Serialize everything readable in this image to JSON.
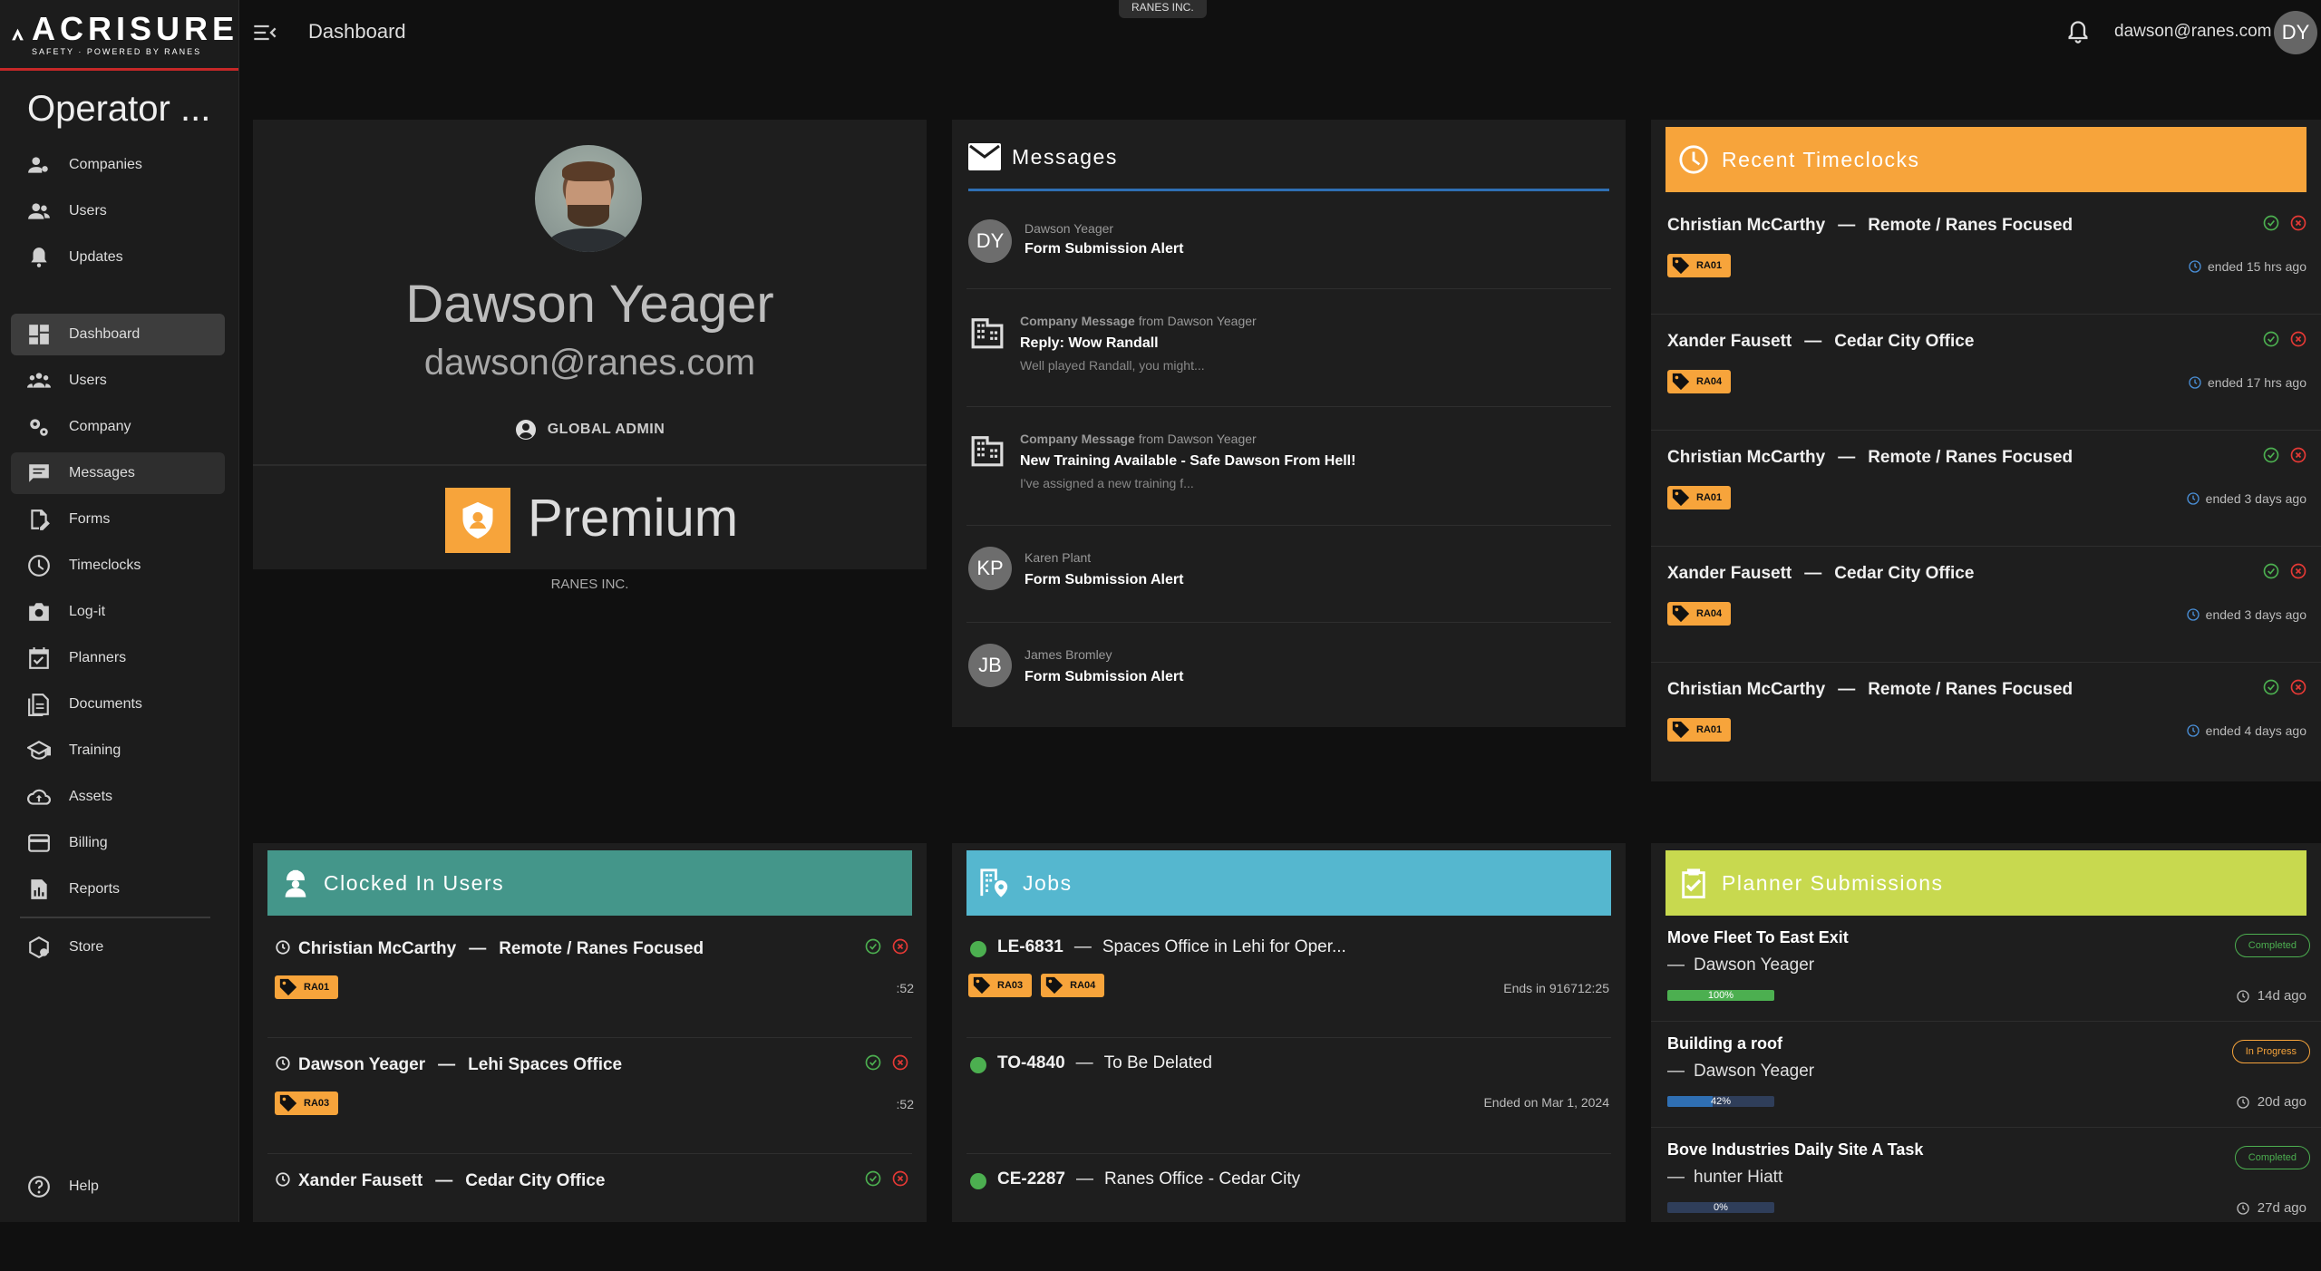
{
  "brand": {
    "name": "ACRISURE",
    "tagline": "SAFETY · POWERED BY RANES"
  },
  "sidebar": {
    "operator_label": "Operator ...",
    "top_items": [
      {
        "label": "Companies",
        "icon": "user-gear-icon"
      },
      {
        "label": "Users",
        "icon": "users-icon"
      },
      {
        "label": "Updates",
        "icon": "bell-icon"
      }
    ],
    "items": [
      {
        "label": "Dashboard",
        "icon": "dashboard-icon",
        "state": "active"
      },
      {
        "label": "Users",
        "icon": "users-icon"
      },
      {
        "label": "Company",
        "icon": "gears-icon"
      },
      {
        "label": "Messages",
        "icon": "message-icon",
        "state": "selected"
      },
      {
        "label": "Forms",
        "icon": "form-edit-icon"
      },
      {
        "label": "Timeclocks",
        "icon": "clock-icon"
      },
      {
        "label": "Log-it",
        "icon": "camera-icon"
      },
      {
        "label": "Planners",
        "icon": "calendar-check-icon"
      },
      {
        "label": "Documents",
        "icon": "documents-icon"
      },
      {
        "label": "Training",
        "icon": "graduation-cap-icon"
      },
      {
        "label": "Assets",
        "icon": "cloud-upload-icon"
      },
      {
        "label": "Billing",
        "icon": "credit-card-icon"
      },
      {
        "label": "Reports",
        "icon": "report-icon"
      }
    ],
    "store_label": "Store",
    "help_label": "Help"
  },
  "topbar": {
    "title": "Dashboard",
    "company_chip": "RANES INC.",
    "user_email": "dawson@ranes.com",
    "user_initials": "DY"
  },
  "profile": {
    "name": "Dawson Yeager",
    "email": "dawson@ranes.com",
    "role": "GLOBAL ADMIN",
    "plan": "Premium",
    "company": "RANES INC."
  },
  "messages": {
    "title": "Messages",
    "items": [
      {
        "kind": "user",
        "initials": "DY",
        "sender": "Dawson Yeager",
        "title": "Form Submission Alert"
      },
      {
        "kind": "company",
        "prefix": "Company Message",
        "from_word": "from",
        "sender": "Dawson Yeager",
        "title": "Reply: Wow Randall",
        "preview": "Well played Randall, you might..."
      },
      {
        "kind": "company",
        "prefix": "Company Message",
        "from_word": "from",
        "sender": "Dawson Yeager",
        "title": "New Training Available - Safe Dawson From Hell!",
        "preview": "I've assigned a new training f..."
      },
      {
        "kind": "user",
        "initials": "KP",
        "sender": "Karen Plant",
        "title": "Form Submission Alert"
      },
      {
        "kind": "user",
        "initials": "JB",
        "sender": "James Bromley",
        "title": "Form Submission Alert"
      }
    ]
  },
  "timeclocks": {
    "title": "Recent Timeclocks",
    "items": [
      {
        "person": "Christian McCarthy",
        "site": "Remote / Ranes Focused",
        "tag": "RA01",
        "ended": "ended 15 hrs ago"
      },
      {
        "person": "Xander Fausett",
        "site": "Cedar City Office",
        "tag": "RA04",
        "ended": "ended 17 hrs ago"
      },
      {
        "person": "Christian McCarthy",
        "site": "Remote / Ranes Focused",
        "tag": "RA01",
        "ended": "ended 3 days ago"
      },
      {
        "person": "Xander Fausett",
        "site": "Cedar City Office",
        "tag": "RA04",
        "ended": "ended 3 days ago"
      },
      {
        "person": "Christian McCarthy",
        "site": "Remote / Ranes Focused",
        "tag": "RA01",
        "ended": "ended 4 days ago"
      }
    ]
  },
  "clocked_in": {
    "title": "Clocked In Users",
    "items": [
      {
        "person": "Christian McCarthy",
        "site": "Remote / Ranes Focused",
        "tag": "RA01",
        "elapsed": ":52"
      },
      {
        "person": "Dawson Yeager",
        "site": "Lehi Spaces Office",
        "tag": "RA03",
        "elapsed": ":52"
      },
      {
        "person": "Xander Fausett",
        "site": "Cedar City Office"
      }
    ]
  },
  "jobs": {
    "title": "Jobs",
    "items": [
      {
        "code": "LE-6831",
        "name": "Spaces Office in Lehi for Oper...",
        "tags": [
          "RA03",
          "RA04"
        ],
        "status": "Ends in 916712:25"
      },
      {
        "code": "TO-4840",
        "name": "To Be Delated",
        "status": "Ended on Mar 1, 2024"
      },
      {
        "code": "CE-2287",
        "name": "Ranes Office - Cedar City"
      }
    ]
  },
  "planners": {
    "title": "Planner Submissions",
    "items": [
      {
        "title": "Move Fleet To East Exit",
        "person": "Dawson Yeager",
        "status": "Completed",
        "progress": 1.0,
        "progress_label": "100%",
        "ago": "14d ago"
      },
      {
        "title": "Building a roof",
        "person": "Dawson Yeager",
        "status": "In Progress",
        "progress": 0.42,
        "progress_label": "42%",
        "ago": "20d ago"
      },
      {
        "title": "Bove Industries Daily Site A Task",
        "person": "hunter Hiatt",
        "status": "Completed",
        "progress": 0.0,
        "progress_label": "0%",
        "ago": "27d ago"
      }
    ]
  },
  "colors": {
    "timeclock_header": "#f7a43b",
    "clocked_header": "#44968a",
    "jobs_header": "#55b7cf",
    "planner_header": "#c8d94f",
    "tag": "#f7a43b",
    "accent_red": "#c62828",
    "ok_green": "#4caf50",
    "cancel_red": "#e53935",
    "progress_green": "#4caf50",
    "progress_blue": "#2f6fb3"
  },
  "dash_separator": "—"
}
